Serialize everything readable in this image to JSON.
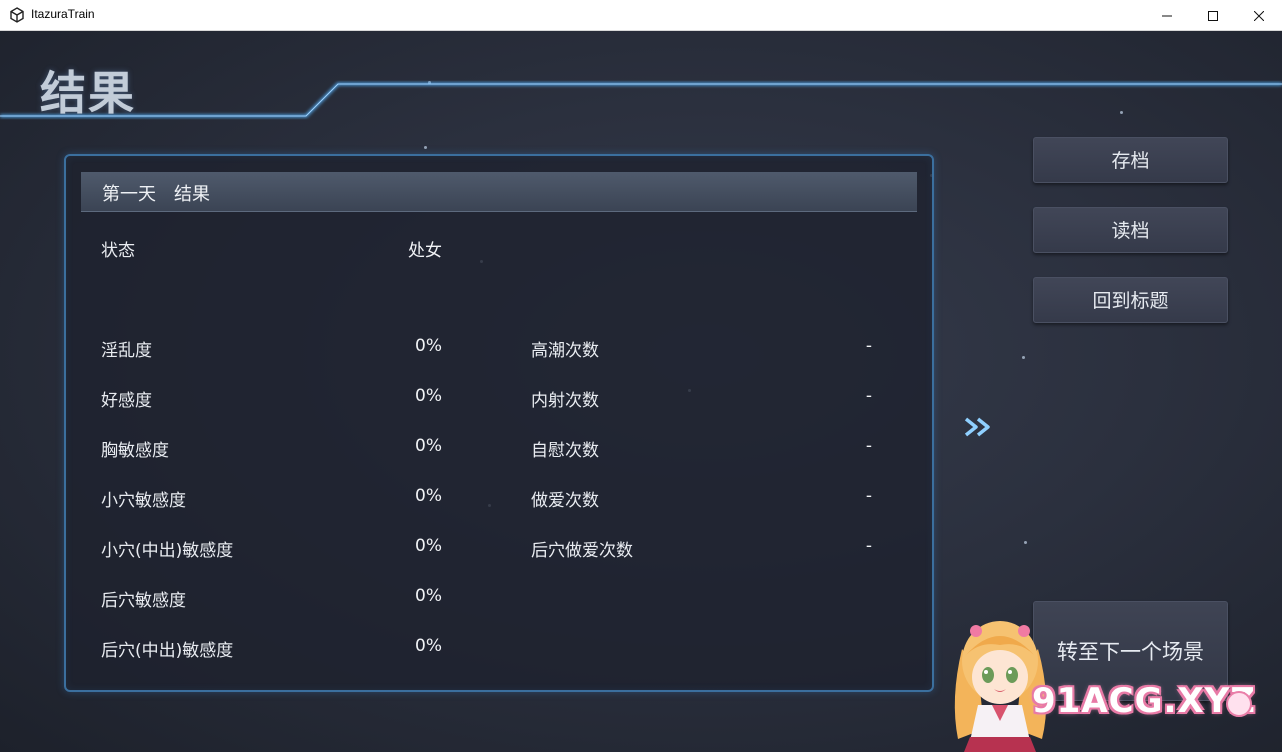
{
  "window": {
    "title": "ItazuraTrain",
    "icon": "unity-logo-icon",
    "controls": [
      "minimize-icon",
      "maximize-icon",
      "close-icon"
    ]
  },
  "page": {
    "title": "结果"
  },
  "panel": {
    "header": "第一天　结果",
    "status_label": "状态",
    "status_value": "处女",
    "left_stats": [
      {
        "label": "淫乱度",
        "value": "0%"
      },
      {
        "label": "好感度",
        "value": "0%"
      },
      {
        "label": "胸敏感度",
        "value": "0%"
      },
      {
        "label": "小穴敏感度",
        "value": "0%"
      },
      {
        "label": "小穴(中出)敏感度",
        "value": "0%"
      },
      {
        "label": "后穴敏感度",
        "value": "0%"
      },
      {
        "label": "后穴(中出)敏感度",
        "value": "0%"
      }
    ],
    "right_stats": [
      {
        "label": "高潮次数",
        "value": "-"
      },
      {
        "label": "内射次数",
        "value": "-"
      },
      {
        "label": "自慰次数",
        "value": "-"
      },
      {
        "label": "做爱次数",
        "value": "-"
      },
      {
        "label": "后穴做爱次数",
        "value": "-"
      }
    ]
  },
  "menu": {
    "save": "存档",
    "load": "读档",
    "back_to_title": "回到标题",
    "next_scene": "转至下一个场景"
  },
  "forward_icon": "double-chevron-right-icon",
  "watermark": {
    "text": "91ACG.XYZ"
  },
  "colors": {
    "accent_glow": "#4fa3e6",
    "panel_border": "#3b6f9e",
    "watermark_pink": "#e87aa6"
  }
}
